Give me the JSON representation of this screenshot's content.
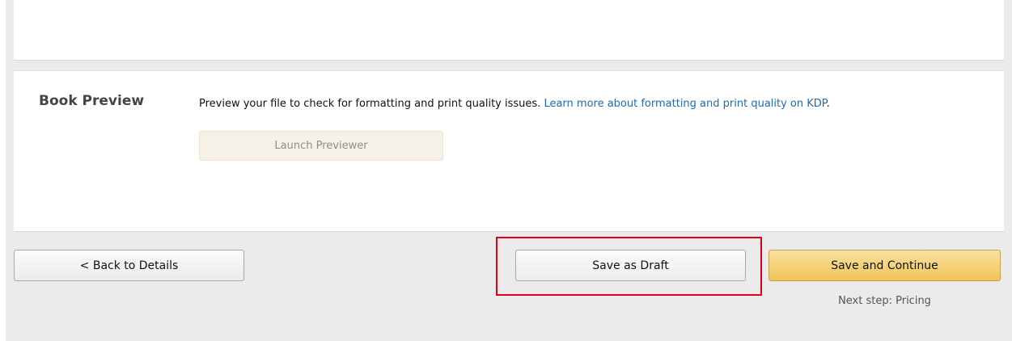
{
  "book_preview": {
    "title": "Book Preview",
    "description": "Preview your file to check for formatting and print quality issues.",
    "learn_more_link": "Learn more about formatting and print quality on KDP",
    "trailing_period": ".",
    "launch_button": "Launch Previewer"
  },
  "footer": {
    "back_button": "< Back to Details",
    "save_draft_button": "Save as Draft",
    "save_continue_button": "Save and Continue",
    "next_step": "Next step: Pricing"
  },
  "colors": {
    "link": "#1f6bb3",
    "primary_button": "#f1c456",
    "highlight_box": "#e2001a",
    "page_background": "#ebebeb"
  }
}
